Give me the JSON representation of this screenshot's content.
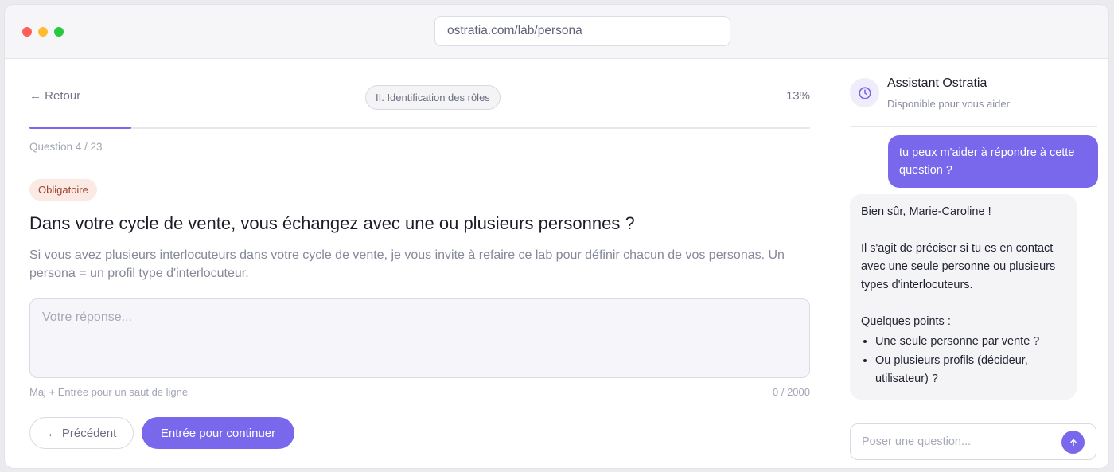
{
  "browser": {
    "url": "ostratia.com/lab/persona"
  },
  "header": {
    "back_label": "← Retour",
    "section": "II. Identification des rôles",
    "percent": "13%",
    "progress": 0.13,
    "question_count": "Question 4 / 23"
  },
  "question": {
    "badge": "Obligatoire",
    "title": "Dans votre cycle de vente, vous échangez avec une ou plusieurs personnes ?",
    "help": "Si vous avez plusieurs interlocuteurs dans votre cycle de vente, je vous invite à refaire ce lab pour définir chacun de vos personas. Un persona = un profil type d'interlocuteur.",
    "answer_value": "",
    "answer_placeholder": "Votre réponse...",
    "hint": "Maj + Entrée pour un saut de ligne",
    "counter": "0 / 2000"
  },
  "actions": {
    "prev_label": "← Précédent",
    "next_label": "Entrée pour continuer"
  },
  "assistant": {
    "avatar_icon": "clock-icon",
    "name": "Assistant Ostratia",
    "status": "Disponible pour vous aider",
    "user_message": "tu peux m'aider à répondre à cette question ?",
    "bot_greeting": "Bien sûr, Marie-Caroline !",
    "bot_explanation": "Il s'agit de préciser si tu es en contact avec une seule personne ou plusieurs types d'interlocuteurs.",
    "bot_points_title": "Quelques points :",
    "bot_points": [
      "Une seule personne par vente ?",
      "Ou plusieurs profils (décideur, utilisateur) ?"
    ],
    "input_value": "",
    "input_placeholder": "Poser une question...",
    "send_icon": "arrow-up-icon"
  },
  "colors": {
    "accent": "#7a68ec",
    "badge_bg": "#fbe9e4",
    "badge_text": "#a1432c"
  }
}
